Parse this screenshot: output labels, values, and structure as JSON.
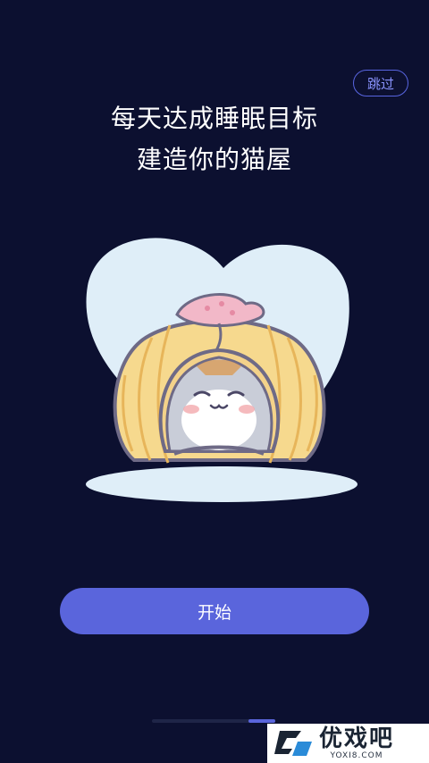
{
  "header": {
    "skip_label": "跳过",
    "title_line1": "每天达成睡眠目标",
    "title_line2": "建造你的猫屋"
  },
  "illustration": {
    "name": "cat-house"
  },
  "actions": {
    "start_label": "开始"
  },
  "pager": {
    "total_pages": 4,
    "active_page": 4
  },
  "watermark": {
    "title": "优戏吧",
    "subtitle": "YOXI8.COM"
  },
  "colors": {
    "background": "#0c1030",
    "accent": "#5a65dc",
    "skip_border": "#5865e0"
  }
}
